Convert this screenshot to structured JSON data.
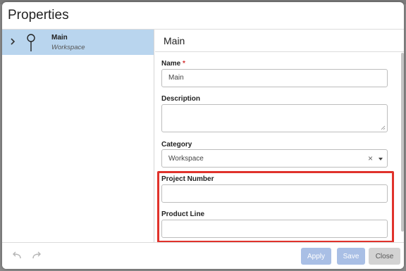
{
  "dialog": {
    "title": "Properties"
  },
  "tree": {
    "items": [
      {
        "name": "Main",
        "subtitle": "Workspace",
        "icon": "pin-icon",
        "expanded": false,
        "selected": true
      }
    ]
  },
  "panel": {
    "header": "Main"
  },
  "form": {
    "name": {
      "label": "Name",
      "required_mark": "*",
      "value": "Main"
    },
    "description": {
      "label": "Description",
      "value": ""
    },
    "category": {
      "label": "Category",
      "value": "Workspace",
      "clear_glyph": "×"
    },
    "project_number": {
      "label": "Project Number",
      "value": ""
    },
    "product_line": {
      "label": "Product Line",
      "value": ""
    }
  },
  "footer": {
    "undo_icon": "undo-icon",
    "redo_icon": "redo-icon",
    "apply_label": "Apply",
    "save_label": "Save",
    "close_label": "Close"
  },
  "colors": {
    "selection": "#b9d5ee",
    "highlight": "#e0322b",
    "primary_disabled": "#a9bfe5",
    "required": "#d32f2f"
  }
}
